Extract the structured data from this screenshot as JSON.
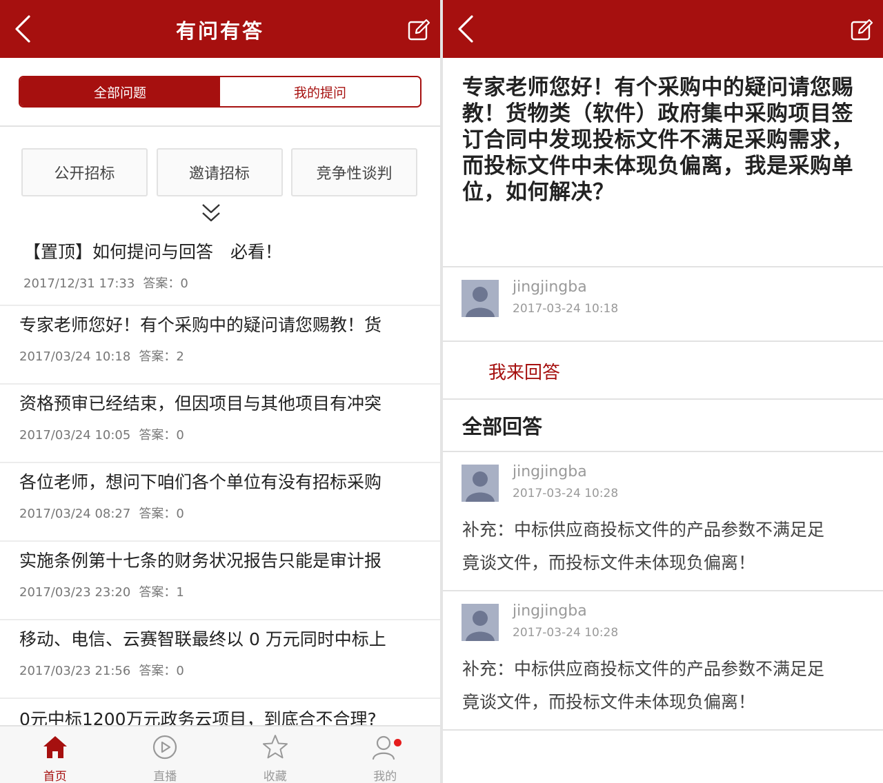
{
  "left": {
    "title": "有问有答",
    "tabs": {
      "all": "全部问题",
      "mine": "我的提问"
    },
    "categories": [
      "公开招标",
      "邀请招标",
      "竞争性谈判"
    ],
    "answers_label": "答案：",
    "questions": [
      {
        "title": "【置顶】如何提问与回答　必看！",
        "time": "2017/12/31 17:33",
        "answers": "0"
      },
      {
        "title": "专家老师您好！有个采购中的疑问请您赐教！货",
        "time": "2017/03/24 10:18",
        "answers": "2"
      },
      {
        "title": "资格预审已经结束，但因项目与其他项目有冲突",
        "time": "2017/03/24 10:05",
        "answers": "0"
      },
      {
        "title": "各位老师，想问下咱们各个单位有没有招标采购",
        "time": "2017/03/24 08:27",
        "answers": "0"
      },
      {
        "title": "实施条例第十七条的财务状况报告只能是审计报",
        "time": "2017/03/23 23:20",
        "answers": "1"
      },
      {
        "title": "移动、电信、云赛智联最终以 0 万元同时中标上",
        "time": "2017/03/23 21:56",
        "answers": "0"
      },
      {
        "title": "0元中标1200万元政务云项目，到底合不合理?"
      }
    ],
    "tabbar": [
      "首页",
      "直播",
      "收藏",
      "我的"
    ]
  },
  "right": {
    "question": "专家老师您好！有个采购中的疑问请您赐教！货物类（软件）政府集中采购项目签订合同中发现投标文件不满足采购需求，而投标文件中未体现负偏离，我是采购单位，如何解决？",
    "asker": {
      "name": "jingjingba",
      "time": "2017-03-24 10:18"
    },
    "answer_button": "我来回答",
    "all_answers_title": "全部回答",
    "answers": [
      {
        "name": "jingjingba",
        "time": "2017-03-24 10:28",
        "text_line1": "补充：中标供应商投标文件的产品参数不满足足",
        "text_line2": "竟谈文件，而投标文件未体现负偏离！"
      },
      {
        "name": "jingjingba",
        "time": "2017-03-24 10:28",
        "text_line1": "补充：中标供应商投标文件的产品参数不满足足",
        "text_line2": "竟谈文件，而投标文件未体现负偏离！"
      }
    ]
  },
  "colors": {
    "brand": "#a6100f",
    "notification_dot": "#e51c1c"
  },
  "icons": [
    "back-icon",
    "edit-icon",
    "double-chevron-down-icon",
    "home-icon",
    "play-icon",
    "star-icon",
    "user-icon"
  ]
}
